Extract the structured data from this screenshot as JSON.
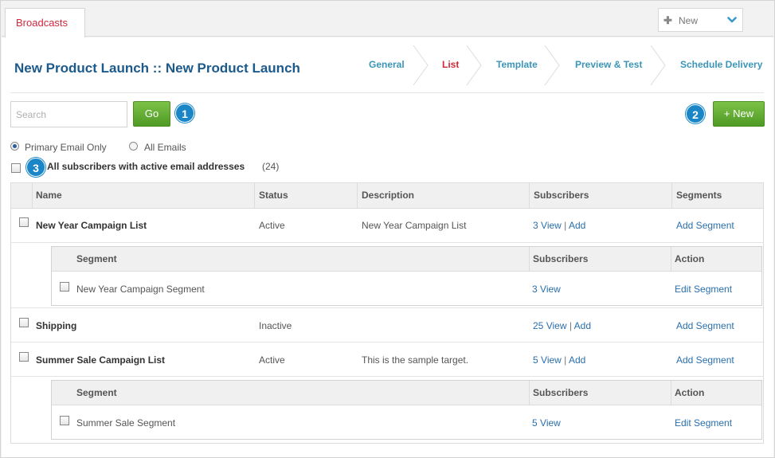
{
  "tab": {
    "label": "Broadcasts"
  },
  "new_dropdown": {
    "label": "New"
  },
  "page": {
    "title": "New Product Launch :: New Product Launch"
  },
  "steps": [
    {
      "label": "General"
    },
    {
      "label": "List"
    },
    {
      "label": "Template"
    },
    {
      "label": "Preview & Test"
    },
    {
      "label": "Schedule Delivery"
    }
  ],
  "search": {
    "placeholder": "Search",
    "go_label": "Go"
  },
  "new_button": {
    "label": "+ New"
  },
  "callouts": [
    "1",
    "2",
    "3"
  ],
  "filters": {
    "primary": "Primary Email Only",
    "all": "All Emails"
  },
  "all_subscribers": {
    "label": "All subscribers with active email addresses",
    "count": "(24)"
  },
  "table": {
    "headers": {
      "name": "Name",
      "status": "Status",
      "description": "Description",
      "subscribers": "Subscribers",
      "segments": "Segments"
    },
    "rows": [
      {
        "name": "New Year Campaign List",
        "status": "Active",
        "description": "New Year Campaign List",
        "count": "3",
        "view": "View",
        "sep": "|",
        "add": "Add",
        "add_segment": "Add Segment",
        "segments": {
          "headers": {
            "segment": "Segment",
            "subscribers": "Subscribers",
            "action": "Action"
          },
          "name": "New Year Campaign Segment",
          "count": "3",
          "view": "View",
          "action": "Edit Segment"
        }
      },
      {
        "name": "Shipping",
        "status": "Inactive",
        "description": "",
        "count": "25",
        "view": "View",
        "sep": "|",
        "add": "Add",
        "add_segment": "Add Segment"
      },
      {
        "name": "Summer Sale Campaign List",
        "status": "Active",
        "description": "This is the sample target.",
        "count": "5",
        "view": "View",
        "sep": "|",
        "add": "Add",
        "add_segment": "Add Segment",
        "segments": {
          "headers": {
            "segment": "Segment",
            "subscribers": "Subscribers",
            "action": "Action"
          },
          "name": "Summer Sale Segment",
          "count": "5",
          "view": "View",
          "action": "Edit Segment"
        }
      }
    ]
  }
}
